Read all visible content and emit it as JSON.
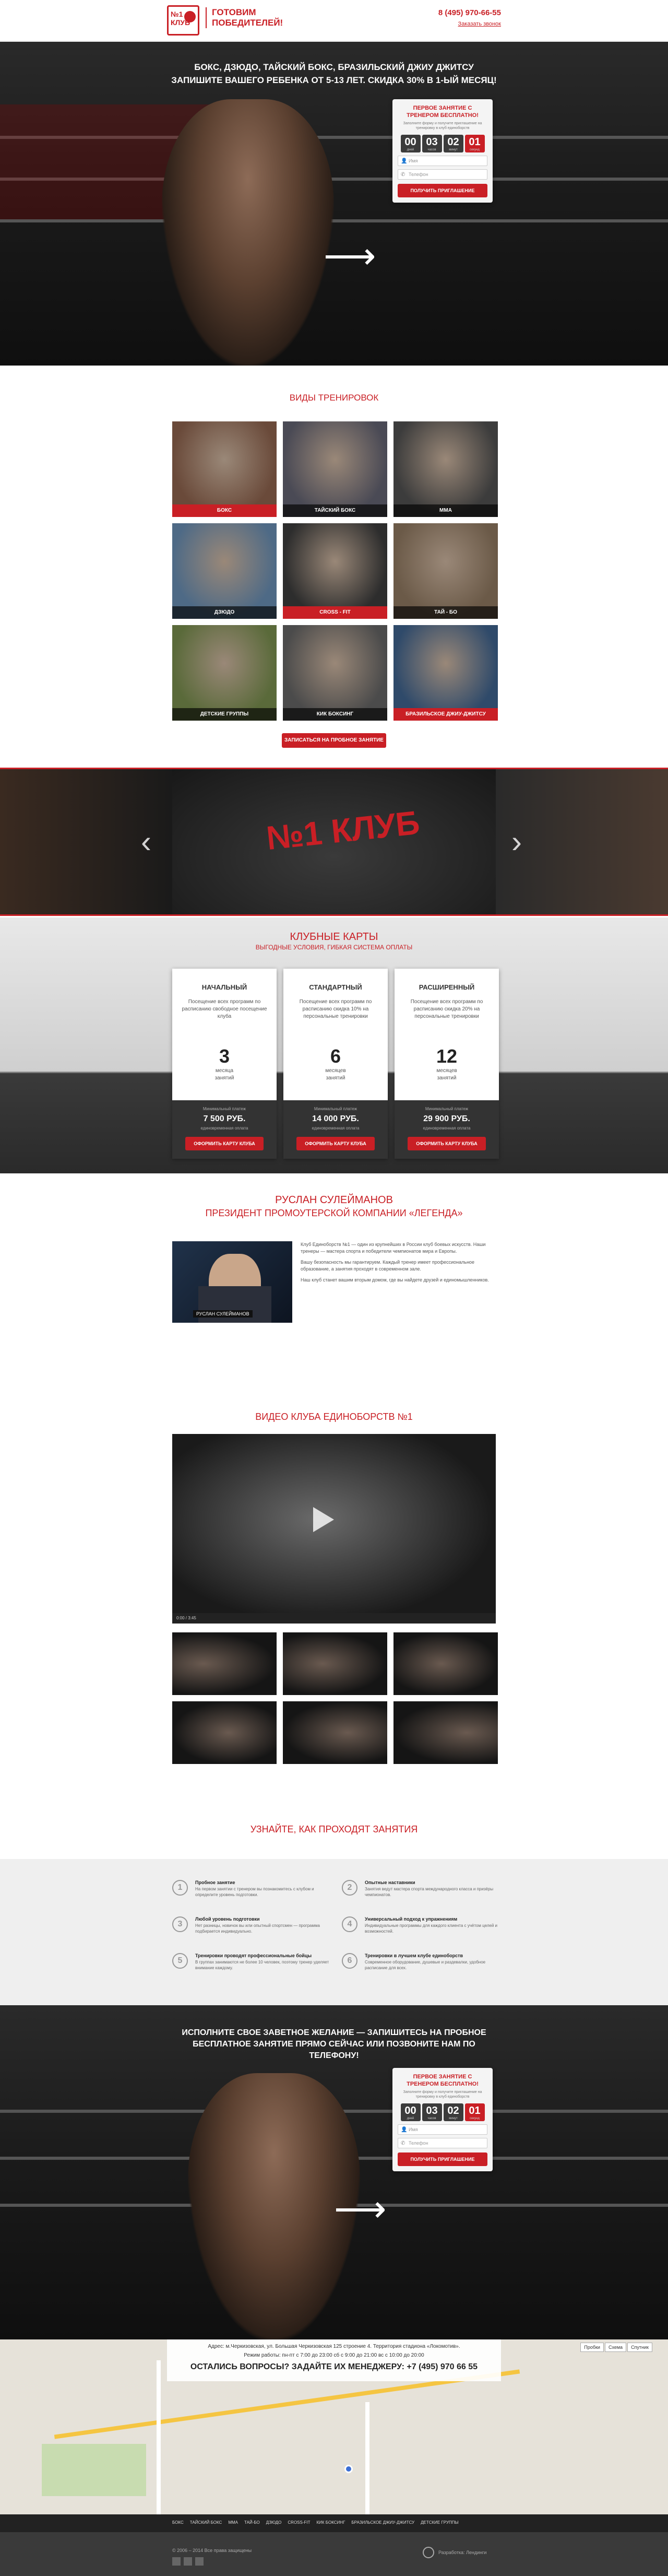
{
  "header": {
    "logo_text": "№1 КЛУБ",
    "tagline": "ГОТОВИМ ПОБЕДИТЕЛЕЙ!",
    "phone": "8 (495) 970-66-55",
    "callback_link": "Заказать звонок"
  },
  "hero": {
    "headline": "БОКС, ДЗЮДО, ТАЙСКИЙ БОКС, БРАЗИЛЬСКИЙ ДЖИУ ДЖИТСУ",
    "subheadline": "ЗАПИШИТЕ ВАШЕГО РЕБЕНКА ОТ 5-13 ЛЕТ. СКИДКА 30% В 1-ЫЙ МЕСЯЦ!",
    "form": {
      "title": "ПЕРВОЕ ЗАНЯТИЕ С ТРЕНЕРОМ БЕСПЛАТНО!",
      "subtitle": "Заполните форму и получите приглашение на тренировку в клуб единоборств",
      "timer": [
        "00",
        "03",
        "02",
        "01"
      ],
      "timer_labels": [
        "дней",
        "часов",
        "минут",
        "секунд"
      ],
      "name_placeholder": "Имя",
      "phone_placeholder": "Телефон",
      "button": "ПОЛУЧИТЬ ПРИГЛАШЕНИЕ"
    }
  },
  "trainings": {
    "title": "ВИДЫ ТРЕНИРОВОК",
    "tiles": [
      {
        "label": "БОКС",
        "tone": "#6a4a3a"
      },
      {
        "label": "ТАЙСКИЙ БОКС",
        "tone": "#4a4a55"
      },
      {
        "label": "ММА",
        "tone": "#3c3c3c"
      },
      {
        "label": "ДЗЮДО",
        "tone": "#4e6a86"
      },
      {
        "label": "CROSS - FIT",
        "tone": "#2d2d2d"
      },
      {
        "label": "ТАЙ - БО",
        "tone": "#6b5a48"
      },
      {
        "label": "ДЕТСКИЕ ГРУППЫ",
        "tone": "#5a6a3a"
      },
      {
        "label": "КИК БОКСИНГ",
        "tone": "#4b4b4b"
      },
      {
        "label": "БРАЗИЛЬСКОЕ ДЖИУ-ДЖИТСУ",
        "tone": "#2f4a6a"
      }
    ],
    "cta": "ЗАПИСАТЬСЯ НА ПРОБНОЕ ЗАНЯТИЕ"
  },
  "slider": {
    "banner_text": "№1 КЛУБ",
    "prev": "‹",
    "next": "›"
  },
  "plans": {
    "title": "КЛУБНЫЕ КАРТЫ",
    "subtitle": "ВЫГОДНЫЕ УСЛОВИЯ, ГИБКАЯ СИСТЕМА ОПЛАТЫ",
    "items": [
      {
        "name": "НАЧАЛЬНЫЙ",
        "desc": "Посещение всех программ по расписанию свободное посещение клуба",
        "num": "3",
        "unit1": "месяца",
        "unit2": "занятий",
        "label": "Минимальный платеж",
        "price": "7 500 РУБ.",
        "note": "единовременная оплата",
        "button": "ОФОРМИТЬ КАРТУ КЛУБА"
      },
      {
        "name": "СТАНДАРТНЫЙ",
        "desc": "Посещение всех программ по расписанию скидка 10% на персональные тренировки",
        "num": "6",
        "unit1": "месяцев",
        "unit2": "занятий",
        "label": "Минимальный платеж",
        "price": "14 000 РУБ.",
        "note": "единовременная оплата",
        "button": "ОФОРМИТЬ КАРТУ КЛУБА"
      },
      {
        "name": "РАСШИРЕННЫЙ",
        "desc": "Посещение всех программ по расписанию скидка 20% на персональные тренировки",
        "num": "12",
        "unit1": "месяцев",
        "unit2": "занятий",
        "label": "Минимальный платеж",
        "price": "29 900 РУБ.",
        "note": "единовременная оплата",
        "button": "ОФОРМИТЬ КАРТУ КЛУБА"
      }
    ]
  },
  "president": {
    "name": "РУСЛАН СУЛЕЙМАНОВ",
    "role": "ПРЕЗИДЕНТ ПРОМОУТЕРСКОЙ КОМПАНИИ «ЛЕГЕНДА»",
    "image_caption": "РУСЛАН СУЛЕЙМАНОВ",
    "paragraphs": [
      "Клуб Единоборств №1 — один из крупнейших в России клуб боевых искусств. Наши тренеры — мастера спорта и победители чемпионатов мира и Европы.",
      "Вашу безопасность мы гарантируем. Каждый тренер имеет профессиональное образование, а занятия проходят в современном зале.",
      "Наш клуб станет вашим вторым домом, где вы найдете друзей и единомышленников."
    ]
  },
  "video": {
    "title": "ВИДЕО КЛУБА ЕДИНОБОРСТВ №1",
    "controls_time": "0:00 / 3:45"
  },
  "how": {
    "title": "УЗНАЙТЕ, КАК ПРОХОДЯТ ЗАНЯТИЯ",
    "steps": [
      {
        "n": "1",
        "title": "Пробное занятие",
        "desc": "На первом занятии с тренером вы познакомитесь с клубом и определите уровень подготовки."
      },
      {
        "n": "2",
        "title": "Опытные наставники",
        "desc": "Занятия ведут мастера спорта международного класса и призёры чемпионатов."
      },
      {
        "n": "3",
        "title": "Любой уровень подготовки",
        "desc": "Нет разницы, новичок вы или опытный спортсмен — программа подбирается индивидуально."
      },
      {
        "n": "4",
        "title": "Универсальный подход к упражнениям",
        "desc": "Индивидуальные программы для каждого клиента с учётом целей и возможностей."
      },
      {
        "n": "5",
        "title": "Тренировки проводят профессиональные бойцы",
        "desc": "В группах занимаются не более 10 человек, поэтому тренер уделяет внимание каждому."
      },
      {
        "n": "6",
        "title": "Тренировки в лучшем клубе единоборств",
        "desc": "Современное оборудование, душевые и раздевалки, удобное расписание для всех."
      }
    ]
  },
  "hero2": {
    "headline": "ИСПОЛНИТЕ СВОЕ ЗАВЕТНОЕ ЖЕЛАНИЕ — ЗАПИШИТЕСЬ НА ПРОБНОЕ БЕСПЛАТНОЕ ЗАНЯТИЕ ПРЯМО СЕЙЧАС ИЛИ ПОЗВОНИТЕ НАМ ПО ТЕЛЕФОНУ!"
  },
  "contacts": {
    "address": "Адрес: м.Черкизовская, ул. Большая Черкизовская 125 строение 4. Территория стадиона «Локомотив».",
    "schedule": "Режим работы: пн-пт с 7:00 до 23:00 сб с 9:00 до 21:00 вс с 10:00 до 20:00",
    "question": "ОСТАЛИСЬ ВОПРОСЫ? ЗАДАЙТЕ ИХ МЕНЕДЖЕРУ: +7 (495) 970 66 55",
    "map_tabs": [
      "Пробки",
      "Схема",
      "Спутник"
    ]
  },
  "footer": {
    "nav": [
      "БОКС",
      "ТАЙСКИЙ БОКС",
      "ММА",
      "ТАЙ-БО",
      "ДЗЮДО",
      "CROSS-FIT",
      "КИК БОКСИНГ",
      "БРАЗИЛЬСКОЕ ДЖИУ-ДЖИТСУ",
      "ДЕТСКИЕ ГРУППЫ"
    ],
    "copyright": "© 2006 – 2014 Все права защищены",
    "dev_label": "Разработка: Лендинги"
  },
  "colors": {
    "accent": "#c91f25",
    "dark": "#222222"
  }
}
